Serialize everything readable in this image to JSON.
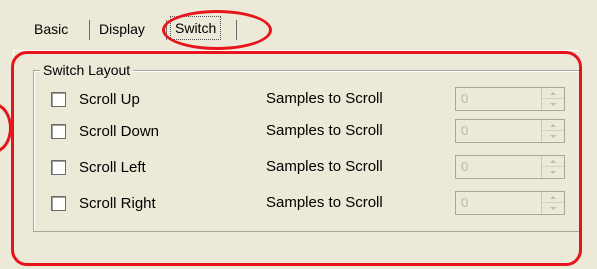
{
  "tabs": [
    {
      "label": "Basic"
    },
    {
      "label": "Display"
    },
    {
      "label": "Switch"
    }
  ],
  "group": {
    "title": "Switch Layout"
  },
  "rows": [
    {
      "checkbox_label": "Scroll Up",
      "samples_label": "Samples to Scroll",
      "value": "0",
      "checked": false
    },
    {
      "checkbox_label": "Scroll Down",
      "samples_label": "Samples to Scroll",
      "value": "0",
      "checked": false
    },
    {
      "checkbox_label": "Scroll Left",
      "samples_label": "Samples to Scroll",
      "value": "0",
      "checked": false
    },
    {
      "checkbox_label": "Scroll Right",
      "samples_label": "Samples to Scroll",
      "value": "0",
      "checked": false
    }
  ],
  "colors": {
    "background": "#ECE9D8",
    "annotation": "#E8141B",
    "disabled_text": "#B8B6A6"
  },
  "annotations": [
    {
      "shape": "ellipse",
      "target": "tab-switch"
    },
    {
      "shape": "rounded-rect",
      "target": "switch-panel"
    }
  ]
}
